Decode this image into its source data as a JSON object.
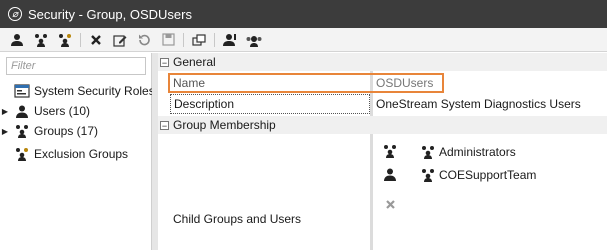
{
  "window": {
    "title": "Security - Group, OSDUsers"
  },
  "toolbar": {
    "buttons": [
      "add-user-icon",
      "add-group-icon",
      "add-exclusion-group-icon",
      "delete-icon",
      "rename-icon",
      "undo-icon",
      "save-icon",
      "copy-icon",
      "user-assign-icon",
      "group-members-icon"
    ]
  },
  "left": {
    "filter_placeholder": "Filter",
    "tree": [
      {
        "label": "System Security Roles",
        "expandable": false
      },
      {
        "label": "Users (10)",
        "expandable": true
      },
      {
        "label": "Groups (17)",
        "expandable": true
      },
      {
        "label": "Exclusion Groups",
        "expandable": false
      }
    ]
  },
  "grid": {
    "sections": {
      "general": "General",
      "membership": "Group Membership"
    },
    "rows": {
      "name_label": "Name",
      "name_value": "OSDUsers",
      "desc_label": "Description",
      "desc_value": "OneStream System Diagnostics Users",
      "child_label": "Child Groups and Users"
    },
    "members": [
      "Administrators",
      "COESupportTeam"
    ]
  },
  "colors": {
    "titlebar": "#3c3c3c",
    "highlight": "#e8853a"
  }
}
